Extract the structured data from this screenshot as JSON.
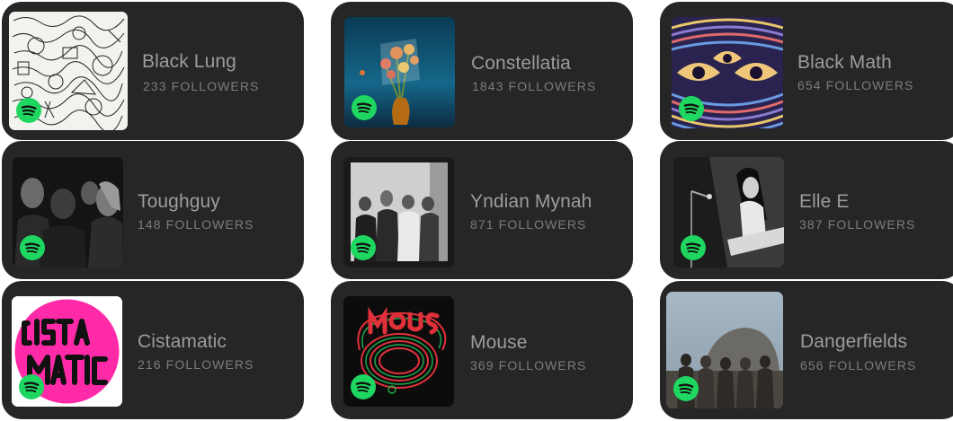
{
  "followers_label": "FOLLOWERS",
  "colors": {
    "card_bg": "#262626",
    "spotify_green": "#1ed760",
    "name_text": "#9c9c9c",
    "followers_text": "#7c7c7c"
  },
  "artists": [
    {
      "name": "Black Lung",
      "followers": "233",
      "icon": "spotify-icon"
    },
    {
      "name": "Constellatia",
      "followers": "1843",
      "icon": "spotify-icon"
    },
    {
      "name": "Black Math",
      "followers": "654",
      "icon": "spotify-icon"
    },
    {
      "name": "Toughguy",
      "followers": "148",
      "icon": "spotify-icon"
    },
    {
      "name": "Yndian Mynah",
      "followers": "871",
      "icon": "spotify-icon"
    },
    {
      "name": "Elle E",
      "followers": "387",
      "icon": "spotify-icon"
    },
    {
      "name": "Cistamatic",
      "followers": "216",
      "icon": "spotify-icon"
    },
    {
      "name": "Mouse",
      "followers": "369",
      "icon": "spotify-icon"
    },
    {
      "name": "Dangerfields",
      "followers": "656",
      "icon": "spotify-icon"
    }
  ]
}
